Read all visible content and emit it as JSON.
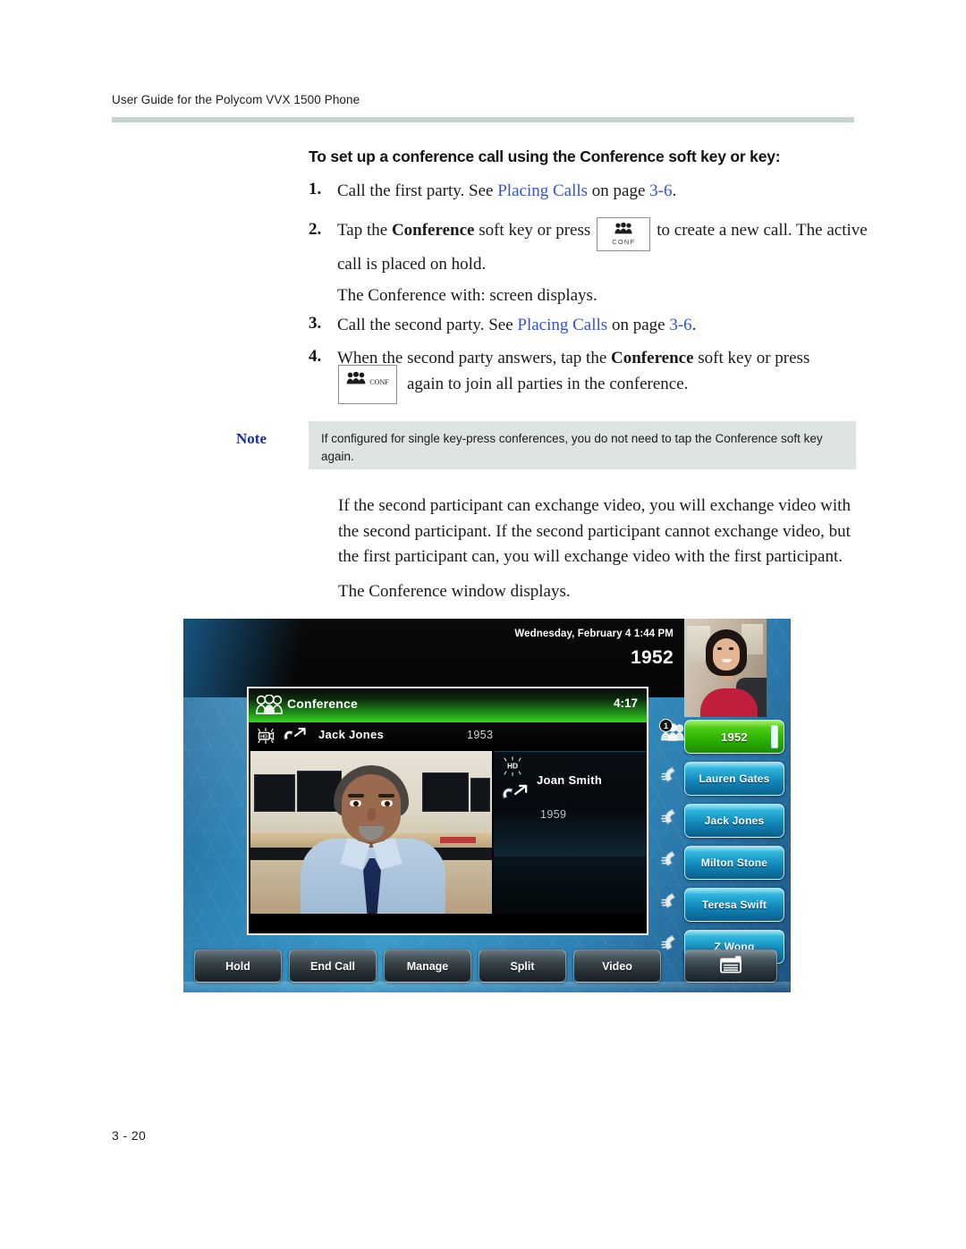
{
  "document": {
    "running_head": "User Guide for the Polycom VVX 1500 Phone",
    "page_number": "3 - 20"
  },
  "procedure": {
    "heading": "To set up a conference call using the Conference soft key or key:",
    "steps": [
      {
        "number": "1.",
        "text_before": "Call the first party. See ",
        "link": "Placing Calls",
        "text_mid": " on page ",
        "link2": "3-6",
        "text_after": "."
      },
      {
        "number": "2.",
        "text_before": "Tap the ",
        "bold": "Conference",
        "text_mid": " soft key or press",
        "text_after": "to create a new call. The active call is placed on hold.",
        "sub_line": "The Conference with: screen displays."
      },
      {
        "number": "3.",
        "text_before": "Call the second party. See ",
        "link": "Placing Calls",
        "text_mid": " on page ",
        "link2": "3-6",
        "text_after": "."
      },
      {
        "number": "4.",
        "text_before": "When the second party answers, tap the ",
        "bold": "Conference",
        "text_mid": " soft key or press",
        "text_after": "again to join all parties in the conference."
      }
    ],
    "conf_key": {
      "label": "CONF",
      "icon": "conference-group-icon"
    }
  },
  "note": {
    "label": "Note",
    "text": "If configured for single key-press conferences, you do not need to tap the Conference soft key again.",
    "background": "#dde4e1",
    "label_color": "#1a2ea0"
  },
  "paragraphs": {
    "video_exchange": "If the second participant can exchange video, you will exchange video with the second participant. If the second participant cannot exchange video, but the first participant can, you will exchange video with the first participant.",
    "window_displays": "The Conference window displays."
  },
  "phone_screen": {
    "status_bar": {
      "date_time": "Wednesday, February 4  1:44 PM",
      "extension": "1952"
    },
    "self_view": {
      "icon": "self-view-video-thumbnail"
    },
    "call_window": {
      "conference_bar": {
        "icon": "conference-group-icon",
        "title": "Conference",
        "timer": "4:17",
        "accent_color": "#35d81e"
      },
      "party_one": {
        "hd_icon": "hd-video-icon",
        "direction_icon": "outgoing-call-icon",
        "name": "Jack Jones",
        "extension": "1953"
      },
      "party_two": {
        "hd_icon": "hd-audio-icon",
        "direction_icon": "outgoing-call-icon",
        "name": "Joan Smith",
        "extension": "1959"
      },
      "far_end_video": {
        "icon": "far-end-video-feed"
      }
    },
    "line_keys": [
      {
        "label": "1952",
        "state": "active",
        "icon": "conference-group-icon",
        "badge": "1",
        "color": "#35d81e",
        "scroll": true
      },
      {
        "label": "Lauren Gates",
        "state": "idle",
        "icon": "handset-icon",
        "color": "#1186b8"
      },
      {
        "label": "Jack Jones",
        "state": "idle",
        "icon": "handset-icon",
        "color": "#1186b8"
      },
      {
        "label": "Milton Stone",
        "state": "idle",
        "icon": "handset-icon",
        "color": "#1186b8"
      },
      {
        "label": "Teresa Swift",
        "state": "idle",
        "icon": "handset-icon",
        "color": "#1186b8"
      },
      {
        "label": "Z Wong",
        "state": "idle",
        "icon": "handset-icon",
        "color": "#1186b8"
      }
    ],
    "soft_keys": [
      {
        "label": "Hold",
        "icon": null
      },
      {
        "label": "End Call",
        "icon": null
      },
      {
        "label": "Manage",
        "icon": null
      },
      {
        "label": "Split",
        "icon": null
      },
      {
        "label": "Video",
        "icon": null
      },
      {
        "label": "",
        "icon": "menu-window-icon"
      }
    ]
  }
}
